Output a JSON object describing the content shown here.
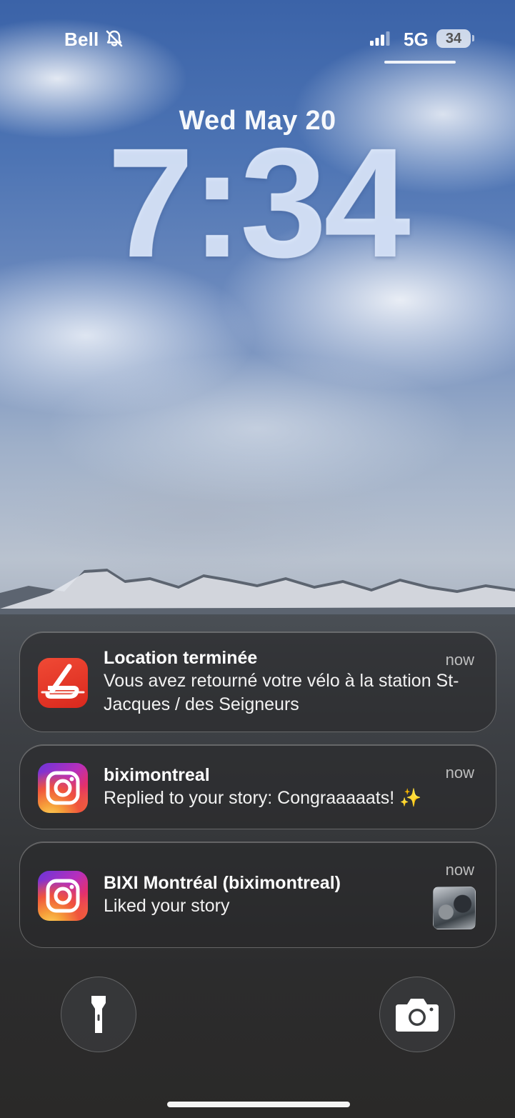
{
  "status_bar": {
    "carrier": "Bell",
    "mute_icon": "bell-slash-icon",
    "signal_icon": "cellular-signal-icon",
    "network": "5G",
    "battery": "34"
  },
  "lock_screen": {
    "date": "Wed May 20",
    "time": "7:34"
  },
  "notifications": [
    {
      "app_icon": "bixi-app-icon",
      "title": "Location terminée",
      "body": "Vous avez retourné votre vélo à la station St-Jacques / des Seigneurs",
      "time": "now"
    },
    {
      "app_icon": "instagram-app-icon",
      "title": "biximontreal",
      "body": "Replied to your story: Congraaaaats! ✨",
      "time": "now"
    },
    {
      "app_icon": "instagram-app-icon",
      "title": "BIXI Montréal (biximontreal)",
      "body": "Liked your story",
      "time": "now",
      "thumbnail": "story-thumbnail"
    }
  ],
  "quick_actions": {
    "left": "flashlight-icon",
    "right": "camera-icon"
  },
  "colors": {
    "bixi_red": "#e8372a",
    "notification_bg": "#28282a"
  }
}
